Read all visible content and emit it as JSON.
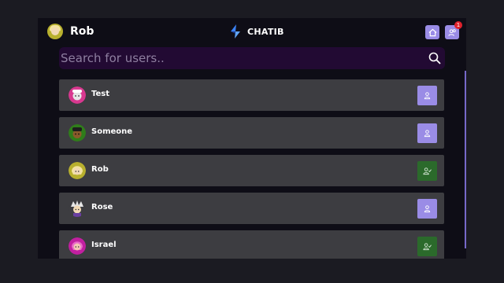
{
  "header": {
    "user_name": "Rob",
    "brand": "CHATIB",
    "notification_count": "1"
  },
  "search": {
    "placeholder": "Search for users.."
  },
  "users": [
    {
      "name": "Test",
      "avatar_color": "#d8388f",
      "status": "add-friend",
      "action_color": "#9a8ce6"
    },
    {
      "name": "Someone",
      "avatar_color": "#2f7d1a",
      "status": "add-friend",
      "action_color": "#9a8ce6"
    },
    {
      "name": "Rob",
      "avatar_color": "#b8b02e",
      "status": "friend",
      "action_color": "#2b6a2b"
    },
    {
      "name": "Rose",
      "avatar_color": "#b98ee0",
      "status": "add-friend",
      "action_color": "#9a8ce6"
    },
    {
      "name": "Israel",
      "avatar_color": "#c21fa0",
      "status": "friend",
      "action_color": "#2b6a2b"
    }
  ],
  "colors": {
    "accent": "#9a8ce6",
    "friend": "#2b6a2b",
    "row_bg": "#3d3d41",
    "page_bg": "#0e0d16",
    "search_bg": "#220a33",
    "badge": "#e0222c"
  }
}
